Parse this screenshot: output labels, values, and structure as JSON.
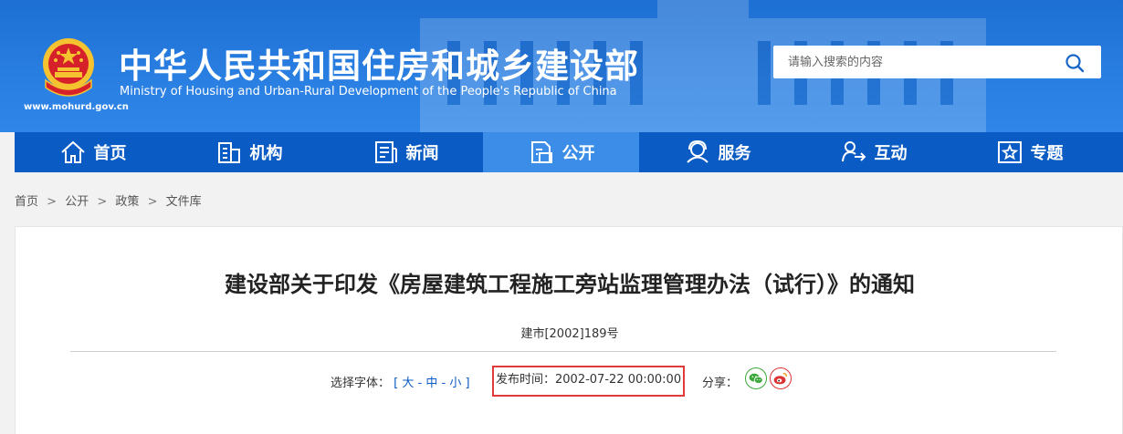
{
  "header": {
    "title": "中华人民共和国住房和城乡建设部",
    "subtitle": "Ministry of Housing and Urban-Rural Development of the People's Republic of China",
    "url": "www.mohurd.gov.cn"
  },
  "search": {
    "placeholder": "请输入搜索的内容"
  },
  "nav": {
    "items": [
      {
        "label": "首页",
        "icon": "home-icon"
      },
      {
        "label": "机构",
        "icon": "building-icon"
      },
      {
        "label": "新闻",
        "icon": "news-icon"
      },
      {
        "label": "公开",
        "icon": "document-icon",
        "active": true
      },
      {
        "label": "服务",
        "icon": "service-icon"
      },
      {
        "label": "互动",
        "icon": "interaction-icon"
      },
      {
        "label": "专题",
        "icon": "star-icon"
      }
    ]
  },
  "breadcrumb": {
    "items": [
      "首页",
      "公开",
      "政策",
      "文件库"
    ],
    "separator": ">"
  },
  "document": {
    "title": "建设部关于印发《房屋建筑工程施工旁站监理管理办法（试行）》的通知",
    "number": "建市[2002]189号"
  },
  "meta": {
    "font_label": "选择字体：",
    "bracket_open": "[",
    "bracket_close": "]",
    "font_large": "大",
    "font_medium": "中",
    "font_small": "小",
    "dash": "-",
    "publish_label": "发布时间：",
    "publish_time": "2002-07-22 00:00:00",
    "share_label": "分享："
  },
  "colors": {
    "header_blue": "#2a7fe2",
    "nav_blue": "#0a5cc4",
    "nav_active": "#3b8de7",
    "highlight_red": "#e03a3a"
  }
}
